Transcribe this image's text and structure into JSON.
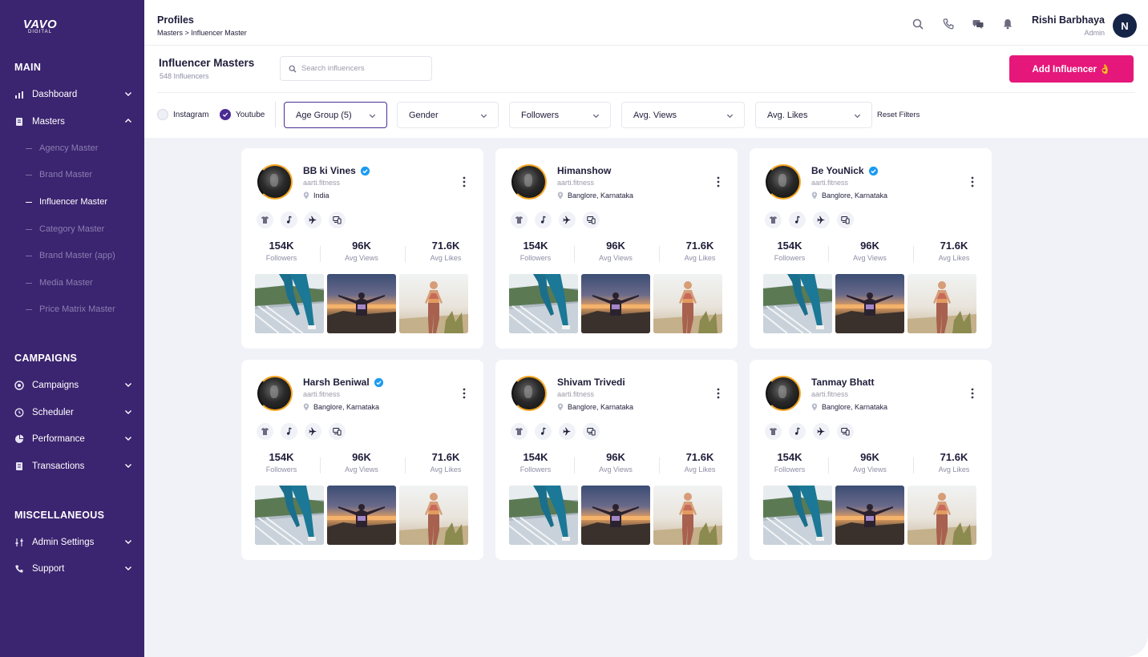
{
  "brand": {
    "name": "VAVO",
    "sub": "DIGITAL"
  },
  "sidebar": {
    "sections": [
      {
        "title": "MAIN"
      },
      {
        "title": "CAMPAIGNS"
      },
      {
        "title": "MISCELLANEOUS"
      }
    ],
    "main_items": [
      {
        "label": "Dashboard",
        "icon": "chart-icon"
      },
      {
        "label": "Masters",
        "icon": "document-icon"
      }
    ],
    "masters_sub": [
      "Agency Master",
      "Brand Master",
      "Influencer Master",
      "Category Master",
      "Brand Master (app)",
      "Media Master",
      "Price Matrix Master"
    ],
    "campaign_items": [
      {
        "label": "Campaigns",
        "icon": "target-icon"
      },
      {
        "label": "Scheduler",
        "icon": "history-icon"
      },
      {
        "label": "Performance",
        "icon": "pie-icon"
      },
      {
        "label": "Transactions",
        "icon": "ledger-icon"
      }
    ],
    "misc_items": [
      {
        "label": "Admin Settings",
        "icon": "sliders-icon"
      },
      {
        "label": "Support",
        "icon": "phone-icon"
      }
    ]
  },
  "header": {
    "title": "Profiles",
    "breadcrumb": "Masters > Influencer Master",
    "user_name": "Rishi Barbhaya",
    "user_role": "Admin",
    "avatar_initial": "N"
  },
  "toolbar": {
    "title": "Influencer Masters",
    "count": "548 Influencers",
    "search_placeholder": "Search influencers",
    "add_button": "Add  Influencer 👌",
    "platforms": [
      {
        "label": "Instagram",
        "checked": false
      },
      {
        "label": "Youtube",
        "checked": true
      }
    ],
    "filters": [
      "Age Group (5)",
      "Gender",
      "Followers",
      "Avg. Views",
      "Avg. Likes"
    ],
    "reset_label": "Reset Filters"
  },
  "stat_labels": [
    "Followers",
    "Avg Views",
    "Avg Likes"
  ],
  "cards": [
    {
      "name": "BB ki Vines",
      "verified": true,
      "handle": "aarti.fitness",
      "location": "India",
      "followers": "154K",
      "views": "96K",
      "likes": "71.6K"
    },
    {
      "name": "Himanshow",
      "verified": false,
      "handle": "aarti.fitness",
      "location": "Banglore, Karnataka",
      "followers": "154K",
      "views": "96K",
      "likes": "71.6K"
    },
    {
      "name": "Be YouNick",
      "verified": true,
      "handle": "aarti.fitness",
      "location": "Banglore, Karnataka",
      "followers": "154K",
      "views": "96K",
      "likes": "71.6K"
    },
    {
      "name": "Harsh Beniwal",
      "verified": true,
      "handle": "aarti.fitness",
      "location": "Banglore, Karnataka",
      "followers": "154K",
      "views": "96K",
      "likes": "71.6K"
    },
    {
      "name": "Shivam Trivedi",
      "verified": false,
      "handle": "aarti.fitness",
      "location": "Banglore, Karnataka",
      "followers": "154K",
      "views": "96K",
      "likes": "71.6K"
    },
    {
      "name": "Tanmay Bhatt",
      "verified": false,
      "handle": "aarti.fitness",
      "location": "Banglore, Karnataka",
      "followers": "154K",
      "views": "96K",
      "likes": "71.6K"
    }
  ],
  "colors": {
    "sidebar": "#3b2470",
    "accent": "#e6177a",
    "primary": "#4b2c94",
    "verified": "#1d9bf0",
    "ring": "#f5a623"
  }
}
